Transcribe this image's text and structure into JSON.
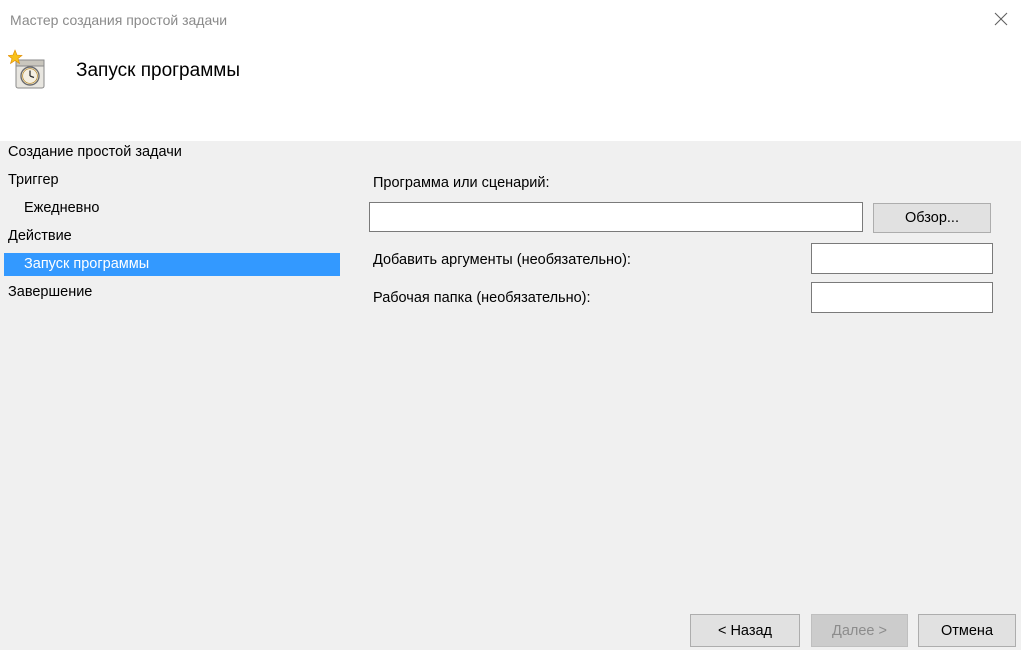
{
  "window": {
    "title": "Мастер создания простой задачи",
    "heading": "Запуск программы"
  },
  "steps": [
    {
      "label": "Создание простой задачи",
      "level": 0,
      "active": false
    },
    {
      "label": "Триггер",
      "level": 0,
      "active": false
    },
    {
      "label": "Ежедневно",
      "level": 1,
      "active": false
    },
    {
      "label": "Действие",
      "level": 0,
      "active": false
    },
    {
      "label": "Запуск программы",
      "level": 1,
      "active": true
    },
    {
      "label": "Завершение",
      "level": 0,
      "active": false
    }
  ],
  "form": {
    "program_label": "Программа или сценарий:",
    "program_value": "",
    "browse_label": "Обзор...",
    "args_label": "Добавить аргументы (необязательно):",
    "args_value": "",
    "workdir_label": "Рабочая папка (необязательно):",
    "workdir_value": ""
  },
  "footer": {
    "back_label": "< Назад",
    "next_label": "Далее >",
    "cancel_label": "Отмена"
  },
  "icons": {
    "close": "close-icon",
    "wizard": "task-scheduler-icon"
  },
  "colors": {
    "selection": "#3399ff",
    "window_bg": "#f0f0f0",
    "header_bg": "#ffffff"
  }
}
